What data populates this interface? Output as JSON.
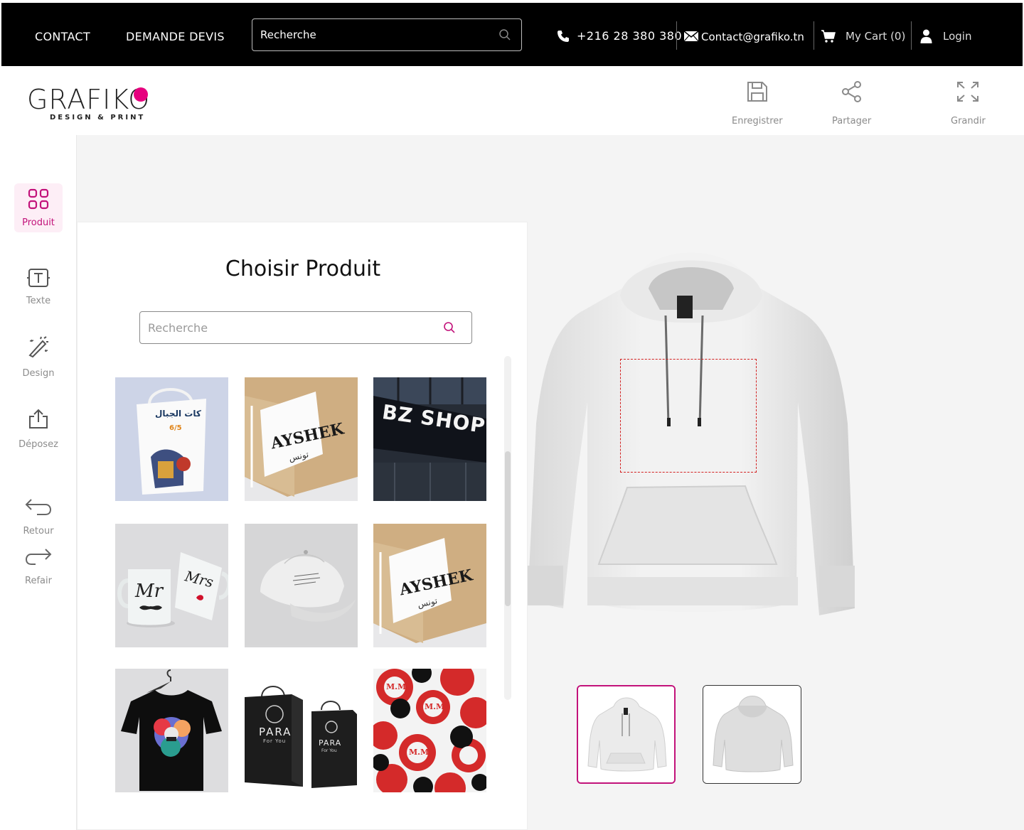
{
  "topbar": {
    "links": [
      "CONTACT",
      "DEMANDE DEVIS"
    ],
    "search_placeholder": "Recherche",
    "phone": "+216 28 380 380",
    "email": "Contact@grafiko.tn",
    "cart": "My Cart (0)",
    "login": "Login"
  },
  "header": {
    "logo_text": "GRAFIKO",
    "logo_sub": "DESIGN & PRINT",
    "actions": [
      "Enregistrer",
      "Partager",
      "Grandir"
    ]
  },
  "rail": {
    "items": [
      {
        "label": "Produit",
        "icon": "grid-icon",
        "active": true
      },
      {
        "label": "Texte",
        "icon": "text-icon"
      },
      {
        "label": "Design",
        "icon": "magic-wand-icon"
      },
      {
        "label": "Déposez",
        "icon": "upload-icon"
      },
      {
        "label": "Retour",
        "icon": "undo-icon"
      },
      {
        "label": "Refair",
        "icon": "redo-icon"
      }
    ]
  },
  "panel": {
    "title": "Choisir Produit",
    "search_placeholder": "Recherche",
    "products": [
      {
        "name": "tote-bag",
        "text": "كات الجبال",
        "sub": "6/5"
      },
      {
        "name": "box-label",
        "text": "AYSHEK",
        "sub": "تونس"
      },
      {
        "name": "shop-sign",
        "text": "BZ SHOP"
      },
      {
        "name": "mugs",
        "text": "Mr",
        "sub": "Mrs"
      },
      {
        "name": "cap",
        "text": ""
      },
      {
        "name": "box-label-2",
        "text": "AYSHEK",
        "sub": "تونس"
      },
      {
        "name": "t-shirt",
        "text": ""
      },
      {
        "name": "shopping-bags",
        "text": "PARA",
        "sub": "For You"
      },
      {
        "name": "stickers",
        "text": "M.M"
      }
    ]
  },
  "preview": {
    "product": "hoodie",
    "views": [
      "front",
      "back"
    ],
    "selected_view": "front"
  },
  "colors": {
    "accent": "#c2127a",
    "brand_dot": "#e6007e",
    "topbar": "#000000"
  }
}
